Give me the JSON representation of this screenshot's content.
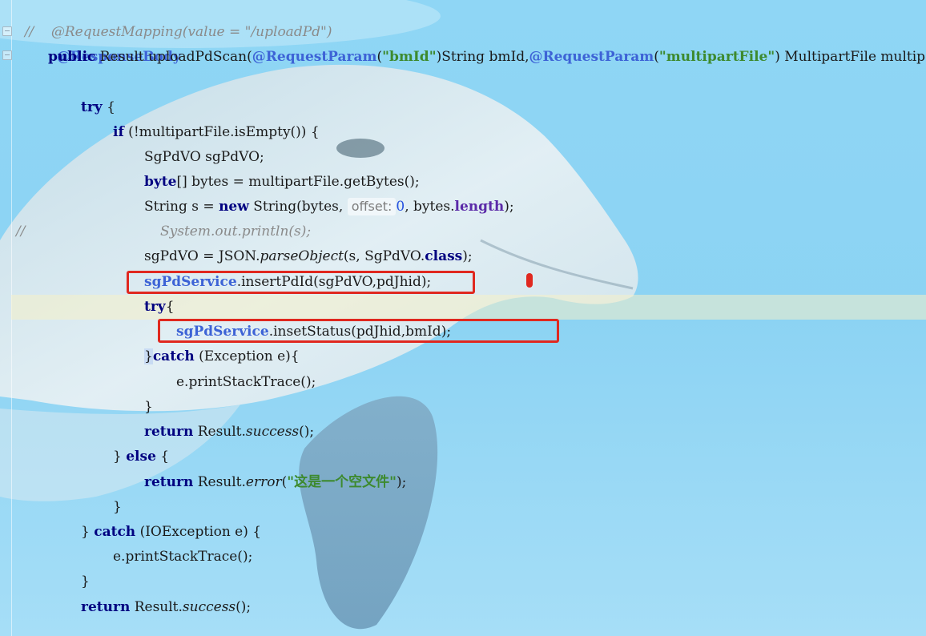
{
  "colors": {
    "keyword": "#000080",
    "annotation": "#3d63d6",
    "string": "#3d8a2e",
    "comment": "#8a8a8a",
    "highlight_box": "#e0281f"
  },
  "code": {
    "l0": [
      "//    @RequestMapping(value = \"/uploadPd\")"
    ],
    "l1": [
      "@ResponseBody"
    ],
    "l2": [
      "public",
      " Result uploadPdScan(",
      "@RequestParam",
      "(",
      "\"bmId\"",
      ")String bmId,",
      "@RequestParam",
      "(",
      "\"multipartFile\"",
      ") MultipartFile multipartFile"
    ],
    "l3": [
      "try",
      " {"
    ],
    "l4": [
      "if",
      " (!multipartFile.isEmpty()) {"
    ],
    "l5": [
      "SgPdVO sgPdVO;"
    ],
    "l6": [
      "byte",
      "[] bytes = multipartFile.getBytes();"
    ],
    "l7": [
      "String s = ",
      "new",
      " String(bytes, ",
      "offset:",
      "0",
      ", bytes.",
      "length",
      ");"
    ],
    "l8": [
      "//",
      "System.out.println(s);"
    ],
    "l9": [
      "sgPdVO = JSON.",
      "parseObject",
      "(s, SgPdVO.",
      "class",
      ");"
    ],
    "l10": [
      "sgPdService",
      ".insertPdId(sgPdVO,pdJhid);"
    ],
    "l11": [
      "try",
      "{"
    ],
    "l12": [
      "sgPdService",
      ".insetStatus(pdJhid,bmId);"
    ],
    "l13": [
      "}",
      "catch",
      " (Exception e){"
    ],
    "l14": [
      "e.printStackTrace();"
    ],
    "l15": [
      "}"
    ],
    "l16": [
      "return",
      " Result.",
      "success",
      "();"
    ],
    "l17": [
      "} ",
      "else",
      " {"
    ],
    "l18": [
      "return",
      " Result.",
      "error",
      "(",
      "\"这是一个空文件\"",
      ");"
    ],
    "l19": [
      "}"
    ],
    "l20": [
      "} ",
      "catch",
      " (IOException e) {"
    ],
    "l21": [
      "e.printStackTrace();"
    ],
    "l22": [
      "}"
    ],
    "l23": [
      "return",
      " Result.",
      "success",
      "();"
    ]
  }
}
